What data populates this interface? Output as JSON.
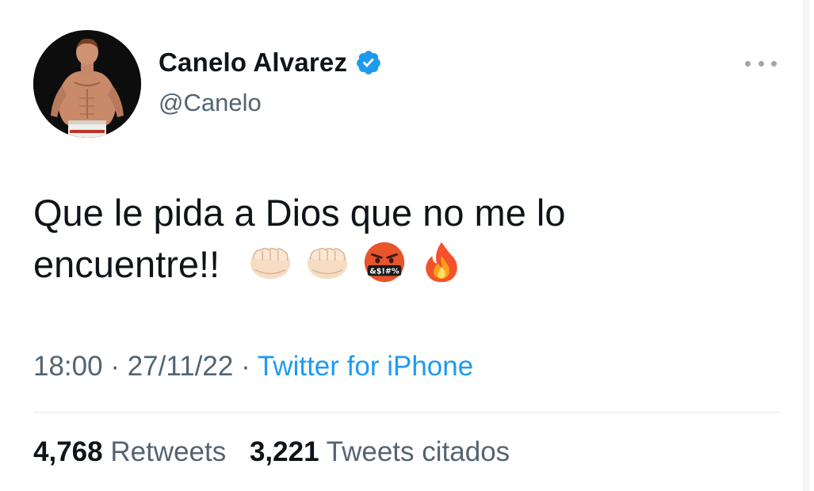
{
  "author": {
    "display_name": "Canelo Alvarez",
    "handle": "@Canelo",
    "verified_color": "#1d9bf0"
  },
  "icons": {
    "verified": "verified-badge-icon",
    "more": "more-options-icon",
    "avatar": "profile-photo"
  },
  "tweet": {
    "text_line1": "Que le pida a Dios que no me lo",
    "text_line2": "encuentre!!",
    "emojis": [
      "oncoming-fist-emoji",
      "oncoming-fist-emoji",
      "cursing-face-emoji",
      "fire-emoji"
    ],
    "cursing_symbols": "&$!#%"
  },
  "meta": {
    "time": "18:00",
    "separator": "·",
    "date": "27/11/22",
    "source": "Twitter for iPhone"
  },
  "stats": {
    "retweets_count": "4,768",
    "retweets_label": "Retweets",
    "quotes_count": "3,221",
    "quotes_label": "Tweets citados"
  },
  "colors": {
    "accent": "#1d9bf0",
    "secondary_text": "#536471",
    "primary_text": "#0f1419"
  }
}
